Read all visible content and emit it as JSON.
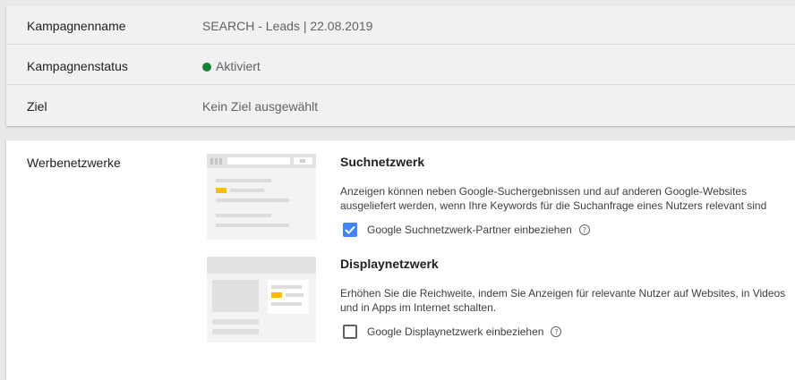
{
  "summary": {
    "rows": [
      {
        "label": "Kampagnenname",
        "value": "SEARCH - Leads | 22.08.2019"
      },
      {
        "label": "Kampagnenstatus",
        "value": "Aktiviert",
        "status_color": "#188038"
      },
      {
        "label": "Ziel",
        "value": "Kein Ziel ausgewählt"
      }
    ]
  },
  "networks": {
    "label": "Werbenetzwerke",
    "search": {
      "title": "Suchnetzwerk",
      "description": "Anzeigen können neben Google-Suchergebnissen und auf anderen Google-Websites ausgeliefert werden, wenn Ihre Keywords für die Suchanfrage eines Nutzers relevant sind",
      "checkbox_label": "Google Suchnetzwerk-Partner einbeziehen",
      "checked": true,
      "help_icon": "question-circle-icon"
    },
    "display": {
      "title": "Displaynetzwerk",
      "description": "Erhöhen Sie die Reichweite, indem Sie Anzeigen für relevante Nutzer auf Websites, in Videos und in Apps im Internet schalten.",
      "checkbox_label": "Google Displaynetzwerk einbeziehen",
      "checked": false,
      "help_icon": "question-circle-icon"
    }
  },
  "colors": {
    "accent": "#4285f4",
    "ad_highlight": "#fbbc04"
  }
}
